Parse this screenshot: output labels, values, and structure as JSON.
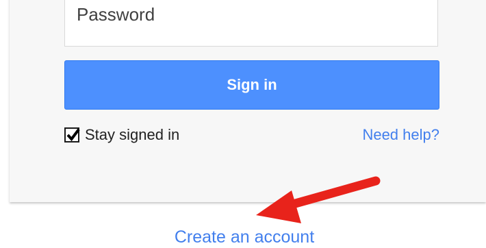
{
  "login_form": {
    "password_placeholder": "Password",
    "sign_in_label": "Sign in",
    "stay_signed_in_label": "Stay signed in",
    "stay_signed_in_checked": true,
    "need_help_label": "Need help?"
  },
  "footer": {
    "create_account_label": "Create an account"
  },
  "colors": {
    "primary_button": "#4d90fe",
    "link": "#427fed",
    "arrow": "#e8231b"
  },
  "icons": {
    "checkbox": "checkmark-icon",
    "annotation": "red-arrow-icon"
  }
}
